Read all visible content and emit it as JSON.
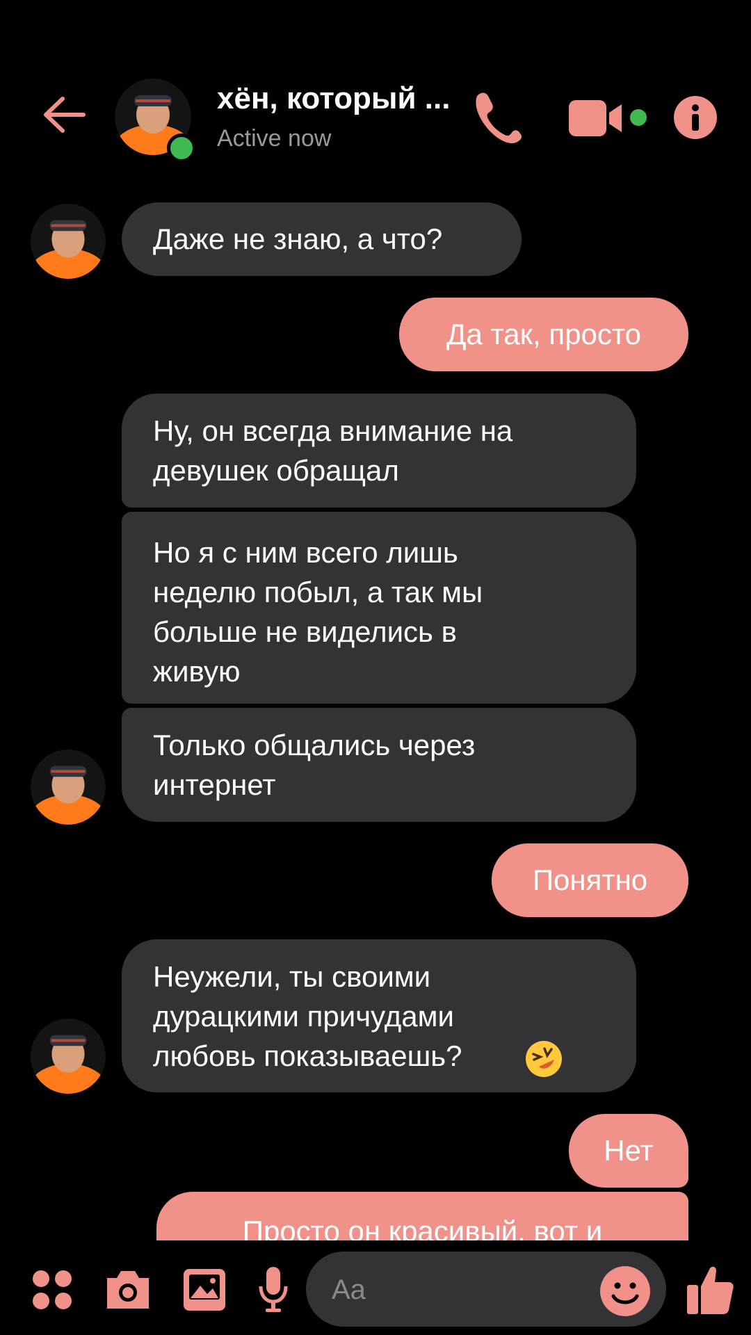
{
  "header": {
    "contact_name": "хён, который ...",
    "status": "Active now"
  },
  "messages": [
    {
      "direction": "in",
      "text": "Даже не знаю, а что?"
    },
    {
      "direction": "out",
      "text": "Да так, просто"
    },
    {
      "direction": "in",
      "text": "Ну, он всегда внимание на\nдевушек обращал"
    },
    {
      "direction": "in",
      "text": "Но я с ним всего лишь\nнеделю побыл, а так мы\nбольше не виделись в\nживую"
    },
    {
      "direction": "in",
      "text": "Только общались через\nинтернет"
    },
    {
      "direction": "out",
      "text": "Понятно"
    },
    {
      "direction": "in",
      "text": "Неужели, ты своими\nдурацкими причудами\nлюбовь показываешь?"
    },
    {
      "direction": "out",
      "text": "Нет"
    },
    {
      "direction": "out",
      "text": "Просто он красивый, вот и"
    }
  ],
  "composer": {
    "placeholder": "Aa"
  },
  "colors": {
    "accent": "#f0918a",
    "incoming_bubble": "#333235",
    "background": "#000000",
    "online": "#3fb950"
  },
  "icons": [
    "back-arrow-icon",
    "phone-icon",
    "video-camera-icon",
    "info-icon",
    "apps-icon",
    "camera-icon",
    "gallery-icon",
    "microphone-icon",
    "emoji-icon",
    "thumbs-up-icon",
    "laughing-emoji-icon"
  ]
}
